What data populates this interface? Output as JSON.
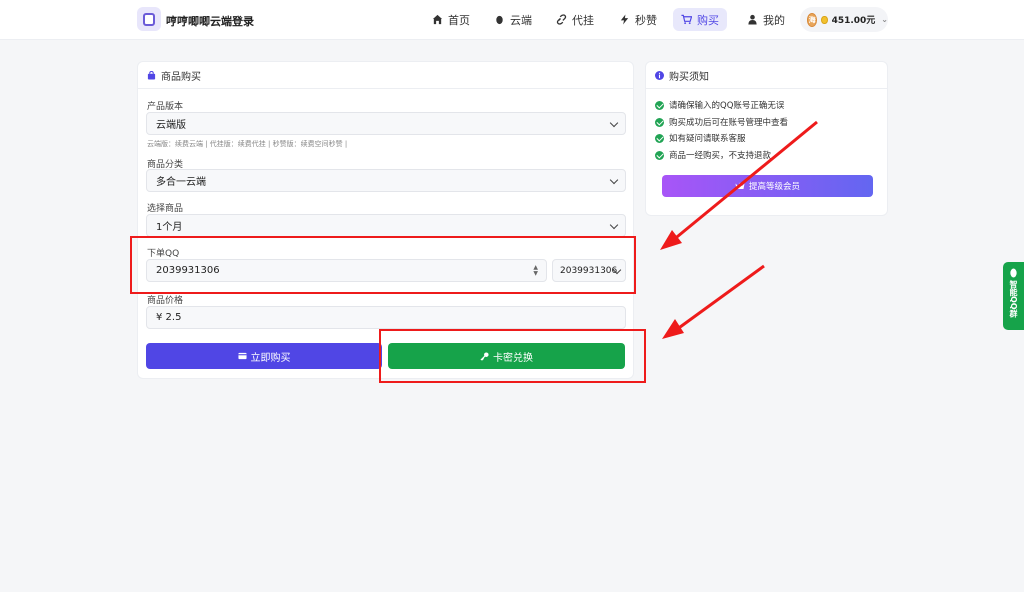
{
  "header": {
    "brand": "哼哼唧唧云端登录",
    "nav": [
      {
        "label": "首页",
        "icon": "home-icon"
      },
      {
        "label": "云端",
        "icon": "penguin-icon"
      },
      {
        "label": "代挂",
        "icon": "link-icon"
      },
      {
        "label": "秒赞",
        "icon": "bolt-icon"
      },
      {
        "label": "购买",
        "icon": "cart-icon",
        "active": true
      },
      {
        "label": "我的",
        "icon": "user-icon"
      }
    ],
    "balance": "451.00元",
    "avatar_text": "海"
  },
  "purchase": {
    "title": "商品购买",
    "version_label": "产品版本",
    "version_value": "云端版",
    "version_hint": "云端版：续费云端 | 代挂版：续费代挂 | 秒赞版：续费空间秒赞 |",
    "category_label": "商品分类",
    "category_value": "多合一云端",
    "product_label": "选择商品",
    "product_value": "1个月",
    "qq_label": "下单QQ",
    "qq_value": "2039931306",
    "qq_select_value": "2039931306",
    "price_label": "商品价格",
    "price_value": "¥ 2.5",
    "buy_button": "立即购买",
    "redeem_button": "卡密兑换"
  },
  "notice": {
    "title": "购买须知",
    "items": [
      "请确保输入的QQ账号正确无误",
      "购买成功后可在账号管理中查看",
      "如有疑问请联系客服",
      "商品一经购买，不支持退款"
    ],
    "vip_button": "提高等级会员"
  },
  "side_tab": "智能QQ群",
  "colors": {
    "accent": "#5046e5",
    "success": "#16a34a",
    "annotation": "#ee1b1b"
  }
}
